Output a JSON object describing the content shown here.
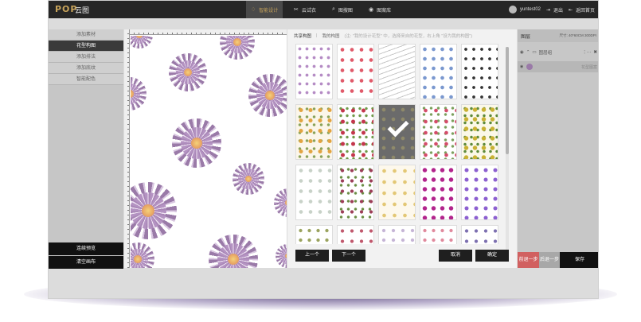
{
  "topbar": {
    "logo": "POP",
    "logo_cn": "云图",
    "nav": [
      {
        "label": "智能设计",
        "icon": "lamp-icon"
      },
      {
        "label": "云试衣",
        "icon": "shirt-icon"
      },
      {
        "label": "图搜图",
        "icon": "search-icon"
      },
      {
        "label": "图案库",
        "icon": "gallery-icon"
      }
    ],
    "username": "yuntest02",
    "logout": "退出",
    "home": "返回首页"
  },
  "left_menu": {
    "items": [
      "添加素材",
      "花型构图",
      "添加排法",
      "添加底纹",
      "智能配色"
    ],
    "active_index": 1,
    "bottom_buttons": [
      "连续预览",
      "清空画布"
    ]
  },
  "pattern_panel": {
    "tabs": [
      "共享构图",
      "我的构图"
    ],
    "hint": "(注: \"我的设计花型\" 中，选择来自的花型，右上角 \"设为我的构图\")",
    "prev_label": "上一个",
    "next_label": "下一个",
    "cancel_label": "取消",
    "confirm_label": "确定",
    "selected_tile_index": 7
  },
  "right_panel": {
    "title": "图层",
    "size_label": "尺寸: 40*60CM 300DPI",
    "group_label": "图层组",
    "layer_label": "花型图案",
    "undo_label": "前退一步",
    "redo_label": "后退一步",
    "save_label": "保存"
  }
}
